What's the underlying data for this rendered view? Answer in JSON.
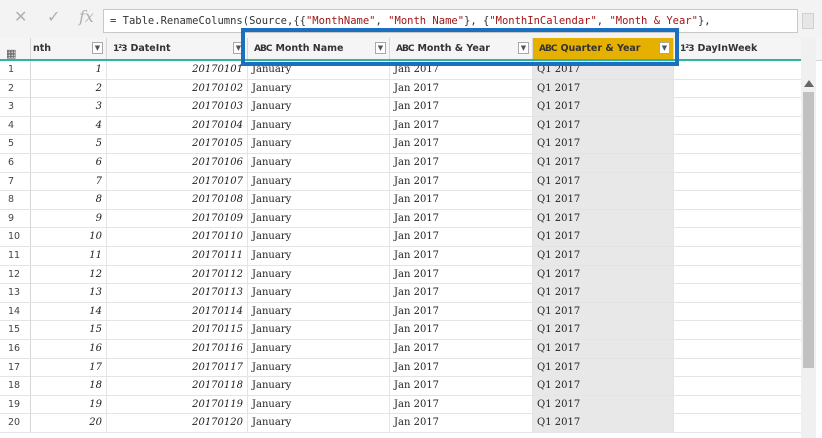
{
  "formula_bar": {
    "prefix": "= Table.RenameColumns(Source,{{",
    "s1": "\"MonthName\"",
    "sep1": ", ",
    "s2": "\"Month Name\"",
    "sep2": "}, {",
    "s3": "\"MonthInCalendar\"",
    "sep3": ", ",
    "s4": "\"Month & Year\"",
    "suffix": "},",
    "fx_label": "fx"
  },
  "columns": [
    {
      "name": "nth",
      "type_icon": "1²3"
    },
    {
      "name": "DateInt",
      "type_icon": "1²3"
    },
    {
      "name": "Month Name",
      "type_icon": "ABC"
    },
    {
      "name": "Month & Year",
      "type_icon": "ABC"
    },
    {
      "name": "Quarter & Year",
      "type_icon": "ABC"
    },
    {
      "name": "DayInWeek",
      "type_icon": "1²3"
    }
  ],
  "rows": [
    {
      "idx": "1",
      "month": "1",
      "dateint": "20170101",
      "month_name": "January",
      "month_year": "Jan 2017",
      "quarter_year": "Q1 2017"
    },
    {
      "idx": "2",
      "month": "2",
      "dateint": "20170102",
      "month_name": "January",
      "month_year": "Jan 2017",
      "quarter_year": "Q1 2017"
    },
    {
      "idx": "3",
      "month": "3",
      "dateint": "20170103",
      "month_name": "January",
      "month_year": "Jan 2017",
      "quarter_year": "Q1 2017"
    },
    {
      "idx": "4",
      "month": "4",
      "dateint": "20170104",
      "month_name": "January",
      "month_year": "Jan 2017",
      "quarter_year": "Q1 2017"
    },
    {
      "idx": "5",
      "month": "5",
      "dateint": "20170105",
      "month_name": "January",
      "month_year": "Jan 2017",
      "quarter_year": "Q1 2017"
    },
    {
      "idx": "6",
      "month": "6",
      "dateint": "20170106",
      "month_name": "January",
      "month_year": "Jan 2017",
      "quarter_year": "Q1 2017"
    },
    {
      "idx": "7",
      "month": "7",
      "dateint": "20170107",
      "month_name": "January",
      "month_year": "Jan 2017",
      "quarter_year": "Q1 2017"
    },
    {
      "idx": "8",
      "month": "8",
      "dateint": "20170108",
      "month_name": "January",
      "month_year": "Jan 2017",
      "quarter_year": "Q1 2017"
    },
    {
      "idx": "9",
      "month": "9",
      "dateint": "20170109",
      "month_name": "January",
      "month_year": "Jan 2017",
      "quarter_year": "Q1 2017"
    },
    {
      "idx": "10",
      "month": "10",
      "dateint": "20170110",
      "month_name": "January",
      "month_year": "Jan 2017",
      "quarter_year": "Q1 2017"
    },
    {
      "idx": "11",
      "month": "11",
      "dateint": "20170111",
      "month_name": "January",
      "month_year": "Jan 2017",
      "quarter_year": "Q1 2017"
    },
    {
      "idx": "12",
      "month": "12",
      "dateint": "20170112",
      "month_name": "January",
      "month_year": "Jan 2017",
      "quarter_year": "Q1 2017"
    },
    {
      "idx": "13",
      "month": "13",
      "dateint": "20170113",
      "month_name": "January",
      "month_year": "Jan 2017",
      "quarter_year": "Q1 2017"
    },
    {
      "idx": "14",
      "month": "14",
      "dateint": "20170114",
      "month_name": "January",
      "month_year": "Jan 2017",
      "quarter_year": "Q1 2017"
    },
    {
      "idx": "15",
      "month": "15",
      "dateint": "20170115",
      "month_name": "January",
      "month_year": "Jan 2017",
      "quarter_year": "Q1 2017"
    },
    {
      "idx": "16",
      "month": "16",
      "dateint": "20170116",
      "month_name": "January",
      "month_year": "Jan 2017",
      "quarter_year": "Q1 2017"
    },
    {
      "idx": "17",
      "month": "17",
      "dateint": "20170117",
      "month_name": "January",
      "month_year": "Jan 2017",
      "quarter_year": "Q1 2017"
    },
    {
      "idx": "18",
      "month": "18",
      "dateint": "20170118",
      "month_name": "January",
      "month_year": "Jan 2017",
      "quarter_year": "Q1 2017"
    },
    {
      "idx": "19",
      "month": "19",
      "dateint": "20170119",
      "month_name": "January",
      "month_year": "Jan 2017",
      "quarter_year": "Q1 2017"
    },
    {
      "idx": "20",
      "month": "20",
      "dateint": "20170120",
      "month_name": "January",
      "month_year": "Jan 2017",
      "quarter_year": "Q1 2017"
    }
  ],
  "colors": {
    "selected_header": "#e6b000",
    "highlight_border": "#1c6fbf",
    "header_accent": "#2eb3a2",
    "selected_column_bg": "#e8e8e8"
  },
  "icons": {
    "cancel": "close-icon",
    "commit": "checkmark-icon",
    "formula": "fx-icon",
    "table": "table-icon",
    "dropdown": "chevron-down-icon"
  }
}
